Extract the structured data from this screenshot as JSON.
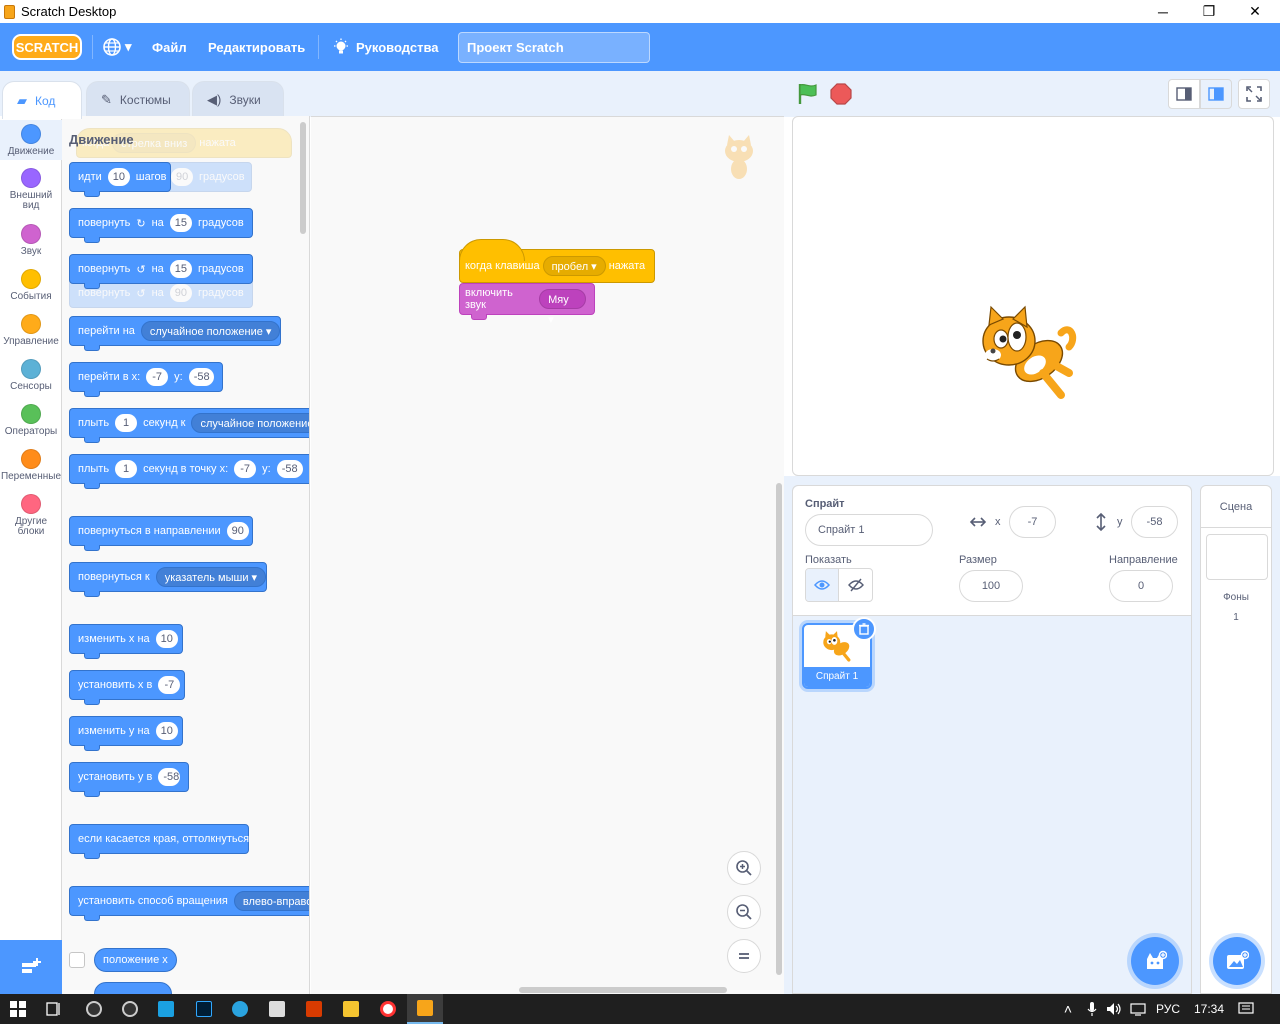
{
  "window": {
    "title": "Scratch Desktop",
    "minimize": "─",
    "maximize": "❐",
    "close": "✕"
  },
  "menu": {
    "logo": "SCRATCH",
    "language_icon": "globe-icon",
    "language_caret": "▾",
    "file": "Файл",
    "edit": "Редактировать",
    "tutorials": "Руководства",
    "project_title": "Проект Scratch"
  },
  "tabs": {
    "code": "Код",
    "costumes": "Костюмы",
    "sounds": "Звуки"
  },
  "categories": [
    {
      "label": "Движение",
      "color": "#4c97ff"
    },
    {
      "label": "Внешний вид",
      "color": "#9966ff"
    },
    {
      "label": "Звук",
      "color": "#cf63cf"
    },
    {
      "label": "События",
      "color": "#ffbf00"
    },
    {
      "label": "Управление",
      "color": "#ffab19"
    },
    {
      "label": "Сенсоры",
      "color": "#5cb1d6"
    },
    {
      "label": "Операторы",
      "color": "#59c059"
    },
    {
      "label": "Переменные",
      "color": "#ff8c1a"
    },
    {
      "label": "Другие блоки",
      "color": "#ff6680"
    }
  ],
  "palette": {
    "section_title": "Движение",
    "ghost_event": {
      "w1": "когда",
      "key": "стрелка вниз",
      "w2": "нажата"
    },
    "ghost_deg": {
      "val": "90",
      "w": "градусов"
    },
    "ghost_turn": {
      "w1": "повернуть",
      "w2": "на",
      "val": "90",
      "w3": "градусов"
    },
    "move": {
      "w1": "идти",
      "val": "10",
      "w2": "шагов"
    },
    "turn_right": {
      "w1": "повернуть",
      "w2": "на",
      "val": "15",
      "w3": "градусов"
    },
    "turn_left": {
      "w1": "повернуть",
      "w2": "на",
      "val": "15",
      "w3": "градусов"
    },
    "goto": {
      "w1": "перейти на",
      "drop": "случайное положение"
    },
    "goto_xy": {
      "w1": "перейти в x:",
      "x": "-7",
      "w2": "y:",
      "y": "-58"
    },
    "glide_to": {
      "w1": "плыть",
      "val": "1",
      "w2": "секунд к",
      "drop": "случайное положение"
    },
    "glide_xy": {
      "w1": "плыть",
      "val": "1",
      "w2": "секунд в точку x:",
      "x": "-7",
      "w3": "y:",
      "y": "-58"
    },
    "point_dir": {
      "w1": "повернуться в направлении",
      "val": "90"
    },
    "point_towards": {
      "w1": "повернуться к",
      "drop": "указатель мыши"
    },
    "change_x": {
      "w1": "изменить x на",
      "val": "10"
    },
    "set_x": {
      "w1": "установить x в",
      "val": "-7"
    },
    "change_y": {
      "w1": "изменить y на",
      "val": "10"
    },
    "set_y": {
      "w1": "установить y в",
      "val": "-58"
    },
    "bounce": {
      "w1": "если касается края, оттолкнуться"
    },
    "rotation": {
      "w1": "установить способ вращения",
      "drop": "влево-вправо"
    },
    "reporter_x": "положение x"
  },
  "script": {
    "event": {
      "w1": "когда клавиша",
      "key": "пробел",
      "w2": "нажата"
    },
    "sound": {
      "w1": "включить звук",
      "drop": "Мяу"
    }
  },
  "sprite_info": {
    "sprite_label": "Спрайт",
    "sprite_name": "Спрайт 1",
    "x_label": "x",
    "x": "-7",
    "y_label": "y",
    "y": "-58",
    "show_label": "Показать",
    "size_label": "Размер",
    "size": "100",
    "direction_label": "Направление",
    "direction": "0"
  },
  "sprite_tile": {
    "name": "Спрайт 1"
  },
  "stage_pane": {
    "title": "Сцена",
    "backdrops_label": "Фоны",
    "backdrops_count": "1"
  },
  "taskbar": {
    "lang": "РУС",
    "time": "17:34"
  },
  "colors": {
    "accent": "#4c97ff",
    "events": "#ffbf00",
    "sound": "#cf63cf"
  }
}
